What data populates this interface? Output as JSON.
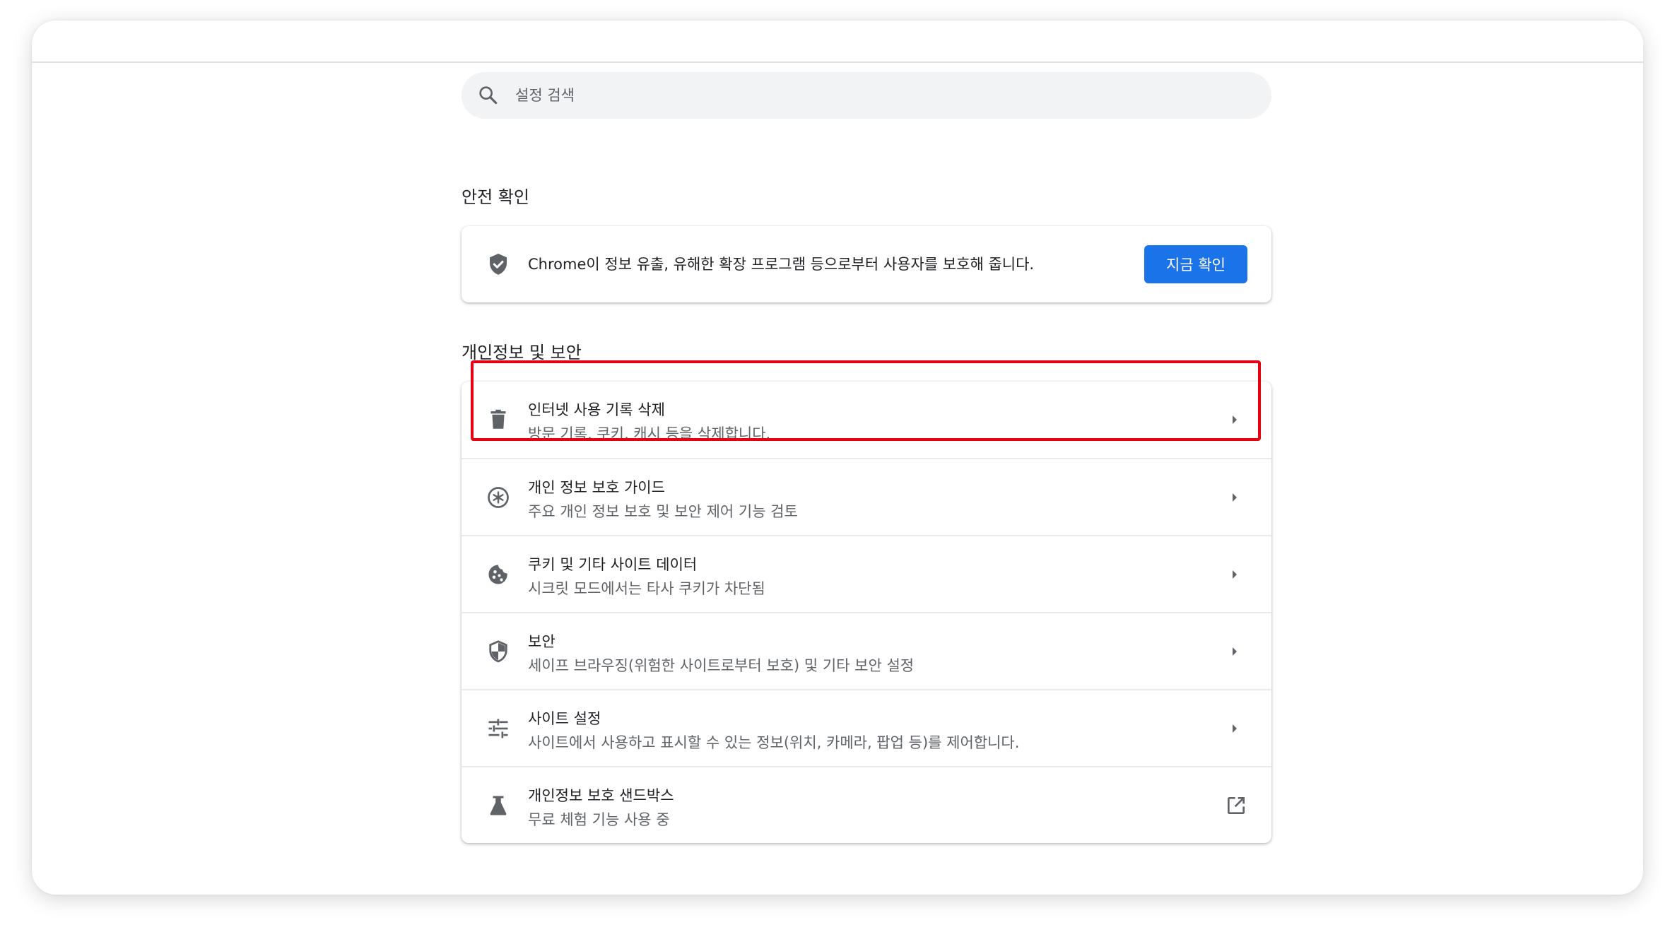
{
  "search": {
    "placeholder": "설정 검색",
    "icon": "search-icon"
  },
  "safety_check": {
    "section_title": "안전 확인",
    "description": "Chrome이 정보 유출, 유해한 확장 프로그램 등으로부터 사용자를 보호해 줍니다.",
    "icon": "shield-check-icon",
    "button_label": "지금 확인",
    "button_color": "#1a73e8"
  },
  "privacy": {
    "section_title": "개인정보 및 보안",
    "items": [
      {
        "title": "인터넷 사용 기록 삭제",
        "subtitle": "방문 기록, 쿠키, 캐시 등을 삭제합니다.",
        "icon": "trash-icon",
        "action": "chevron-right-icon",
        "highlighted": true
      },
      {
        "title": "개인 정보 보호 가이드",
        "subtitle": "주요 개인 정보 보호 및 보안 제어 기능 검토",
        "icon": "privacy-guide-icon",
        "action": "chevron-right-icon"
      },
      {
        "title": "쿠키 및 기타 사이트 데이터",
        "subtitle": "시크릿 모드에서는 타사 쿠키가 차단됨",
        "icon": "cookie-icon",
        "action": "chevron-right-icon"
      },
      {
        "title": "보안",
        "subtitle": "세이프 브라우징(위험한 사이트로부터 보호) 및 기타 보안 설정",
        "icon": "security-shield-icon",
        "action": "chevron-right-icon"
      },
      {
        "title": "사이트 설정",
        "subtitle": "사이트에서 사용하고 표시할 수 있는 정보(위치, 카메라, 팝업 등)를 제어합니다.",
        "icon": "tune-icon",
        "action": "chevron-right-icon"
      },
      {
        "title": "개인정보 보호 샌드박스",
        "subtitle": "무료 체험 기능 사용 중",
        "icon": "flask-icon",
        "action": "open-in-new-icon"
      }
    ]
  },
  "highlight_color": "#e60012"
}
